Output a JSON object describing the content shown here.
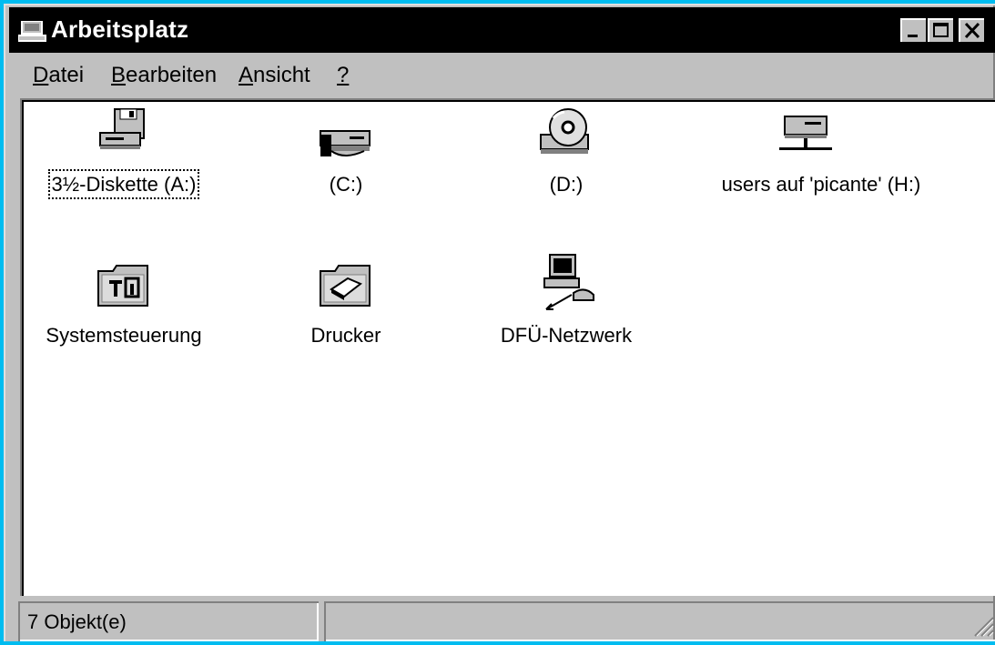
{
  "window": {
    "title": "Arbeitsplatz",
    "buttons": {
      "minimize": "minimize",
      "maximize": "maximize",
      "close": "close"
    }
  },
  "menu": {
    "items": [
      {
        "label": "Datei",
        "accel": "D",
        "rest": "atei"
      },
      {
        "label": "Bearbeiten",
        "accel": "B",
        "rest": "earbeiten"
      },
      {
        "label": "Ansicht",
        "accel": "A",
        "rest": "nsicht"
      },
      {
        "label": "?",
        "accel": "?",
        "rest": ""
      }
    ]
  },
  "items": [
    {
      "label": "3½-Diskette (A:)",
      "icon": "floppy-drive-icon",
      "selected": true
    },
    {
      "label": "(C:)",
      "icon": "hard-drive-icon"
    },
    {
      "label": "(D:)",
      "icon": "cd-rom-drive-icon"
    },
    {
      "label": "users auf 'picante' (H:)",
      "icon": "network-drive-icon"
    },
    {
      "label": "Systemsteuerung",
      "icon": "control-panel-folder-icon"
    },
    {
      "label": "Drucker",
      "icon": "printers-folder-icon"
    },
    {
      "label": "DFÜ-Netzwerk",
      "icon": "dial-up-networking-icon"
    }
  ],
  "status": {
    "count": "7 Objekt(e)"
  },
  "colors": {
    "desktop": "#00bcf0",
    "titlebar": "#000000",
    "face": "#c0c0c0"
  }
}
